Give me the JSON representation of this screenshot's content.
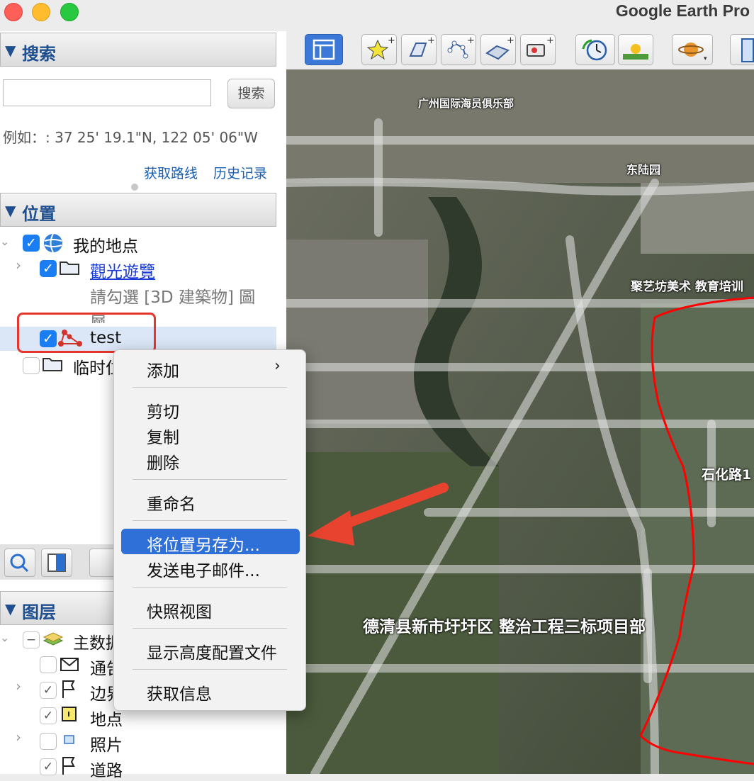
{
  "window": {
    "title": "Google Earth Pro"
  },
  "search": {
    "header": "搜索",
    "input_value": "",
    "button_label": "搜索",
    "example": "例如：: 37 25' 19.1\"N, 122 05' 06\"W",
    "link_directions": "获取路线",
    "link_history": "历史记录"
  },
  "places": {
    "header": "位置",
    "my_places": "我的地点",
    "sightseeing": "觀光遊覽",
    "hint_line1": "請勾選 [3D 建築物] 圖",
    "hint_line2": "層",
    "test": "test",
    "temp": "临时位置"
  },
  "layers": {
    "header": "图层",
    "items": [
      "主数据库",
      "通告",
      "边界和地名",
      "地点",
      "照片",
      "道路"
    ]
  },
  "map": {
    "labels": [
      "广州国际海员俱乐部",
      "东陆园",
      "聚艺坊美术 教育培训",
      "石化路1",
      "德清县新市圩圩区 整治工程三标项目部"
    ],
    "colors": {
      "polygon": "#ff0000",
      "arrow": "#e8432f"
    }
  },
  "context_menu": {
    "add": "添加",
    "cut": "剪切",
    "copy": "复制",
    "delete": "删除",
    "rename": "重命名",
    "save_place_as": "将位置另存为...",
    "send_email": "发送电子邮件...",
    "snapshot": "快照视图",
    "elevation": "显示高度配置文件",
    "get_info": "获取信息"
  }
}
